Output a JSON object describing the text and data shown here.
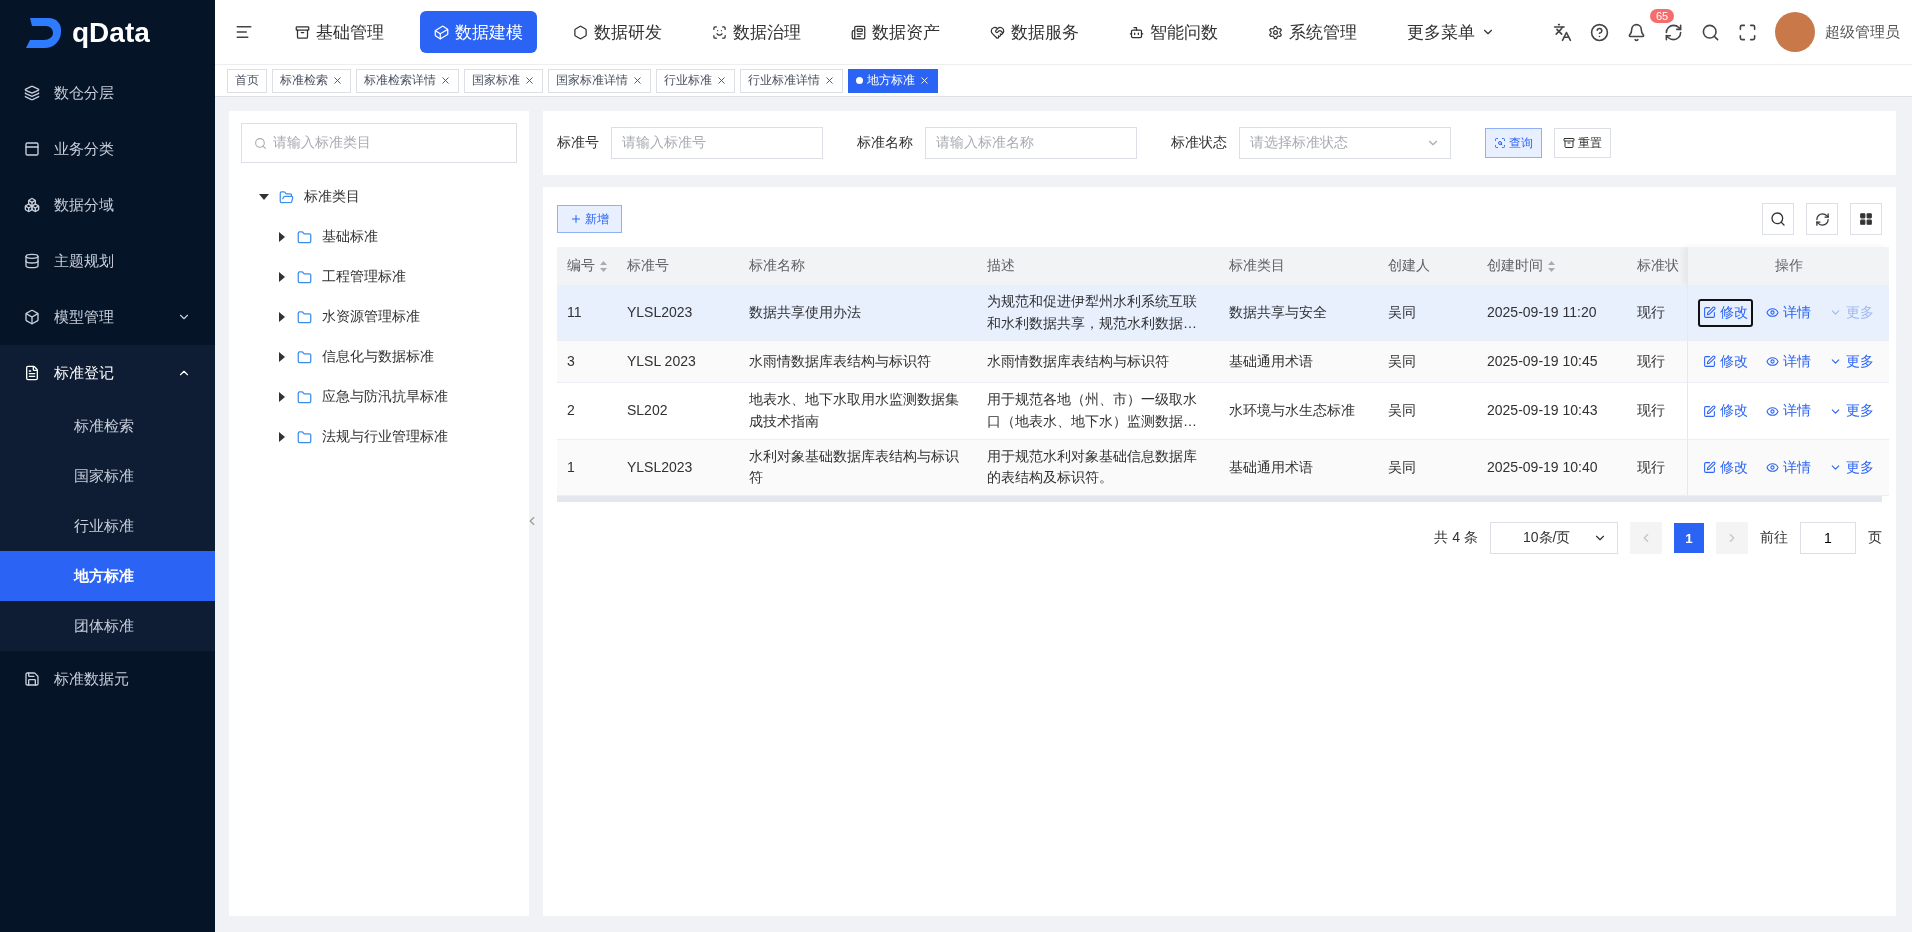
{
  "brand": {
    "name": "qData"
  },
  "sidebar": {
    "items": [
      {
        "label": "数仓分层",
        "selected": false
      },
      {
        "label": "业务分类",
        "selected": false
      },
      {
        "label": "数据分域",
        "selected": false
      },
      {
        "label": "主题规划",
        "selected": false
      },
      {
        "label": "模型管理",
        "selected": false,
        "expanded": false
      },
      {
        "label": "标准登记",
        "selected": false,
        "expanded": true,
        "children": [
          {
            "label": "标准检索",
            "selected": false
          },
          {
            "label": "国家标准",
            "selected": false
          },
          {
            "label": "行业标准",
            "selected": false
          },
          {
            "label": "地方标准",
            "selected": true
          },
          {
            "label": "团体标准",
            "selected": false
          }
        ]
      },
      {
        "label": "标准数据元",
        "selected": false
      }
    ]
  },
  "top_menu": [
    {
      "label": "基础管理",
      "selected": false
    },
    {
      "label": "数据建模",
      "selected": true
    },
    {
      "label": "数据研发",
      "selected": false
    },
    {
      "label": "数据治理",
      "selected": false
    },
    {
      "label": "数据资产",
      "selected": false
    },
    {
      "label": "数据服务",
      "selected": false
    },
    {
      "label": "智能问数",
      "selected": false
    },
    {
      "label": "系统管理",
      "selected": false
    },
    {
      "label": "更多菜单",
      "selected": false
    }
  ],
  "header": {
    "notification_count": "65",
    "user_name": "超级管理员"
  },
  "page_tabs": [
    {
      "label": "首页",
      "selected": false,
      "closable": false
    },
    {
      "label": "标准检索",
      "selected": false,
      "closable": true
    },
    {
      "label": "标准检索详情",
      "selected": false,
      "closable": true
    },
    {
      "label": "国家标准",
      "selected": false,
      "closable": true
    },
    {
      "label": "国家标准详情",
      "selected": false,
      "closable": true
    },
    {
      "label": "行业标准",
      "selected": false,
      "closable": true
    },
    {
      "label": "行业标准详情",
      "selected": false,
      "closable": true
    },
    {
      "label": "地方标准",
      "selected": true,
      "closable": true
    }
  ],
  "tree": {
    "search_placeholder": "请输入标准类目",
    "root": {
      "label": "标准类目",
      "expanded": true,
      "children": [
        {
          "label": "基础标准",
          "expanded": false
        },
        {
          "label": "工程管理标准",
          "expanded": false
        },
        {
          "label": "水资源管理标准",
          "expanded": false
        },
        {
          "label": "信息化与数据标准",
          "expanded": false
        },
        {
          "label": "应急与防汛抗旱标准",
          "expanded": false
        },
        {
          "label": "法规与行业管理标准",
          "expanded": false
        }
      ]
    }
  },
  "filters": [
    {
      "kind": "input",
      "label": "标准号",
      "placeholder": "请输入标准号"
    },
    {
      "kind": "input",
      "label": "标准名称",
      "placeholder": "请输入标准名称"
    },
    {
      "kind": "select",
      "label": "标准状态",
      "placeholder": "请选择标准状态"
    }
  ],
  "filter_buttons": [
    {
      "kind": "primary",
      "label": "查询"
    },
    {
      "kind": "plain",
      "label": "重置"
    }
  ],
  "add_button": "新增",
  "table": {
    "columns": [
      {
        "label": "编号",
        "sortable": true
      },
      {
        "label": "标准号",
        "sortable": false
      },
      {
        "label": "标准名称",
        "sortable": false
      },
      {
        "label": "描述",
        "sortable": false
      },
      {
        "label": "标准类目",
        "sortable": false
      },
      {
        "label": "创建人",
        "sortable": false
      },
      {
        "label": "创建时间",
        "sortable": true
      },
      {
        "label": "标准状",
        "sortable": false
      },
      {
        "label": "操作",
        "sortable": false
      }
    ],
    "rows": [
      {
        "hovered": true,
        "cells": [
          "11",
          "YLSL2023",
          "数据共享使用办法",
          "为规范和促进伊犁州水利系统互联和水利数据共享，规范水利数据…",
          "数据共享与安全",
          "吴同",
          "2025-09-19 11:20",
          "现行"
        ],
        "actions": [
          "修改",
          "详情",
          "更多"
        ]
      },
      {
        "hovered": false,
        "cells": [
          "3",
          "YLSL 2023",
          "水雨情数据库表结构与标识符",
          "水雨情数据库表结构与标识符",
          "基础通用术语",
          "吴同",
          "2025-09-19 10:45",
          "现行"
        ],
        "actions": [
          "修改",
          "详情",
          "更多"
        ]
      },
      {
        "hovered": false,
        "cells": [
          "2",
          "SL202",
          "地表水、地下水取用水监测数据集成技术指南",
          "用于规范各地（州、市）一级取水口（地表水、地下水）监测数据…",
          "水环境与水生态标准",
          "吴同",
          "2025-09-19 10:43",
          "现行"
        ],
        "actions": [
          "修改",
          "详情",
          "更多"
        ]
      },
      {
        "hovered": false,
        "cells": [
          "1",
          "YLSL2023",
          "水利对象基础数据库表结构与标识符",
          "用于规范水利对象基础信息数据库的表结构及标识符。",
          "基础通用术语",
          "吴同",
          "2025-09-19 10:40",
          "现行"
        ],
        "actions": [
          "修改",
          "详情",
          "更多"
        ]
      }
    ]
  },
  "pagination": {
    "total": "共 4 条",
    "page_size": "10条/页",
    "pages": [
      {
        "label": "1",
        "selected": true
      }
    ],
    "goto_label": "前往",
    "goto_value": "1",
    "goto_suffix": "页"
  }
}
